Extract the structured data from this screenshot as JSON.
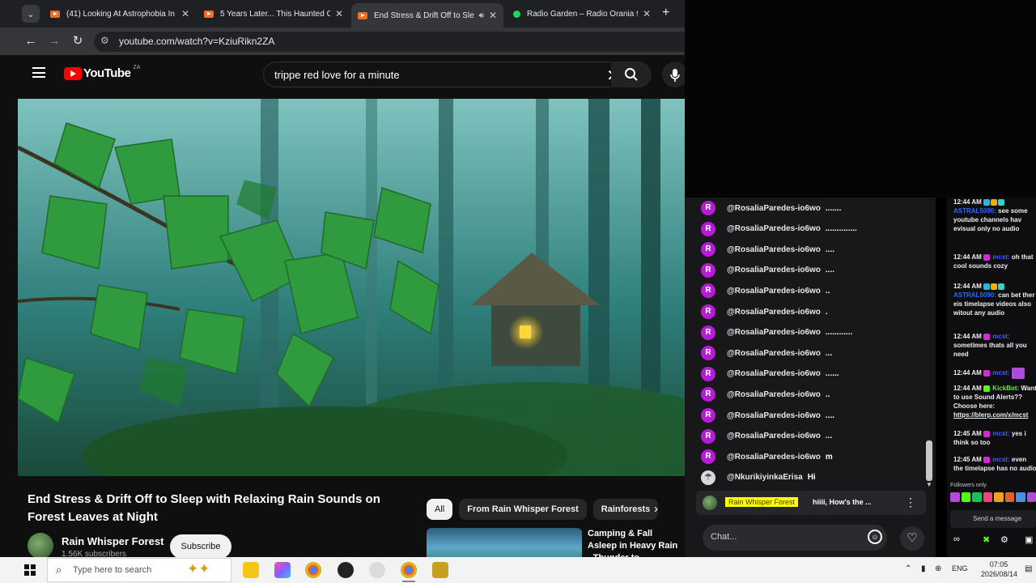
{
  "browser": {
    "tabs": [
      {
        "title": "(41) Looking At Astrophobia In",
        "favicon": "youtube-icon",
        "active": false
      },
      {
        "title": "5 Years Later... This Haunted Ca",
        "favicon": "youtube-icon",
        "active": false
      },
      {
        "title": "End Stress & Drift Off to Sle",
        "favicon": "youtube-icon",
        "active": true,
        "audio": true
      },
      {
        "title": "Radio Garden – Radio Orania 9",
        "favicon": "radio-garden-icon",
        "active": false
      }
    ],
    "url": "youtube.com/watch?v=KziuRikn2ZA"
  },
  "youtube": {
    "logo_text": "YouTube",
    "country_code": "ZA",
    "search_query": "trippe red love for a minute",
    "video_title": "End Stress & Drift Off to Sleep with Relaxing Rain Sounds on Forest Leaves at Night",
    "channel_name": "Rain Whisper Forest",
    "subscribers": "1.56K subscribers",
    "subscribe_label": "Subscribe",
    "chips": [
      "All",
      "From Rain Whisper Forest",
      "Rainforests"
    ],
    "recommended_title": "Camping & Fall Asleep in Heavy Rain - Thunder to..."
  },
  "kick_chat": {
    "messages": [
      {
        "avatar": "R",
        "user": "@RosaliaParedes-io6wo",
        "text": "......."
      },
      {
        "avatar": "R",
        "user": "@RosaliaParedes-io6wo",
        "text": ".............."
      },
      {
        "avatar": "R",
        "user": "@RosaliaParedes-io6wo",
        "text": "...."
      },
      {
        "avatar": "R",
        "user": "@RosaliaParedes-io6wo",
        "text": "...."
      },
      {
        "avatar": "R",
        "user": "@RosaliaParedes-io6wo",
        "text": ".."
      },
      {
        "avatar": "R",
        "user": "@RosaliaParedes-io6wo",
        "text": "."
      },
      {
        "avatar": "R",
        "user": "@RosaliaParedes-io6wo",
        "text": "............"
      },
      {
        "avatar": "R",
        "user": "@RosaliaParedes-io6wo",
        "text": "..."
      },
      {
        "avatar": "R",
        "user": "@RosaliaParedes-io6wo",
        "text": "......"
      },
      {
        "avatar": "R",
        "user": "@RosaliaParedes-io6wo",
        "text": ".."
      },
      {
        "avatar": "R",
        "user": "@RosaliaParedes-io6wo",
        "text": "...."
      },
      {
        "avatar": "R",
        "user": "@RosaliaParedes-io6wo",
        "text": "..."
      },
      {
        "avatar": "R",
        "user": "@RosaliaParedes-io6wo",
        "text": "m"
      },
      {
        "avatar": "",
        "user": "@NkurikiyinkaErisa",
        "text": "Hi"
      }
    ],
    "pinned_name": "Rain Whisper Forest",
    "pinned_text": "hiiii, How's the ...",
    "input_placeholder": "Chat..."
  },
  "side_chat": {
    "messages": [
      {
        "time": "12:44 AM",
        "user": "ASTRAL5090:",
        "text": "see some youtube channels hav evisual only no audio",
        "style": "a"
      },
      {
        "time": "12:44 AM",
        "user": "mcst:",
        "text": "oh that cool sounds cozy",
        "style": "m"
      },
      {
        "time": "12:44 AM",
        "user": "ASTRAL5090:",
        "text": "can bet ther eis timelapse videos also witout any audio",
        "style": "a"
      },
      {
        "time": "12:44 AM",
        "user": "mcst:",
        "text": "sometimes thats all you need",
        "style": "m"
      },
      {
        "time": "12:44 AM",
        "user": "mcst:",
        "text": "",
        "style": "m"
      },
      {
        "time": "12:44 AM",
        "user": "KickBot:",
        "text": "Want to use Sound Alerts?? Choose here:",
        "style": "k",
        "link": "https://blerp.com/x/mcst"
      },
      {
        "time": "12:45 AM",
        "user": "mcst:",
        "text": "yes i think so too",
        "style": "m"
      },
      {
        "time": "12:45 AM",
        "user": "mcst:",
        "text": "even the timelapse has no audio",
        "style": "m"
      }
    ],
    "followers_only": "Followers only",
    "send_placeholder": "Send a message"
  },
  "taskbar": {
    "search_placeholder": "Type here to search",
    "language": "ENG",
    "time": "07:05",
    "date": "2026/08/14"
  }
}
